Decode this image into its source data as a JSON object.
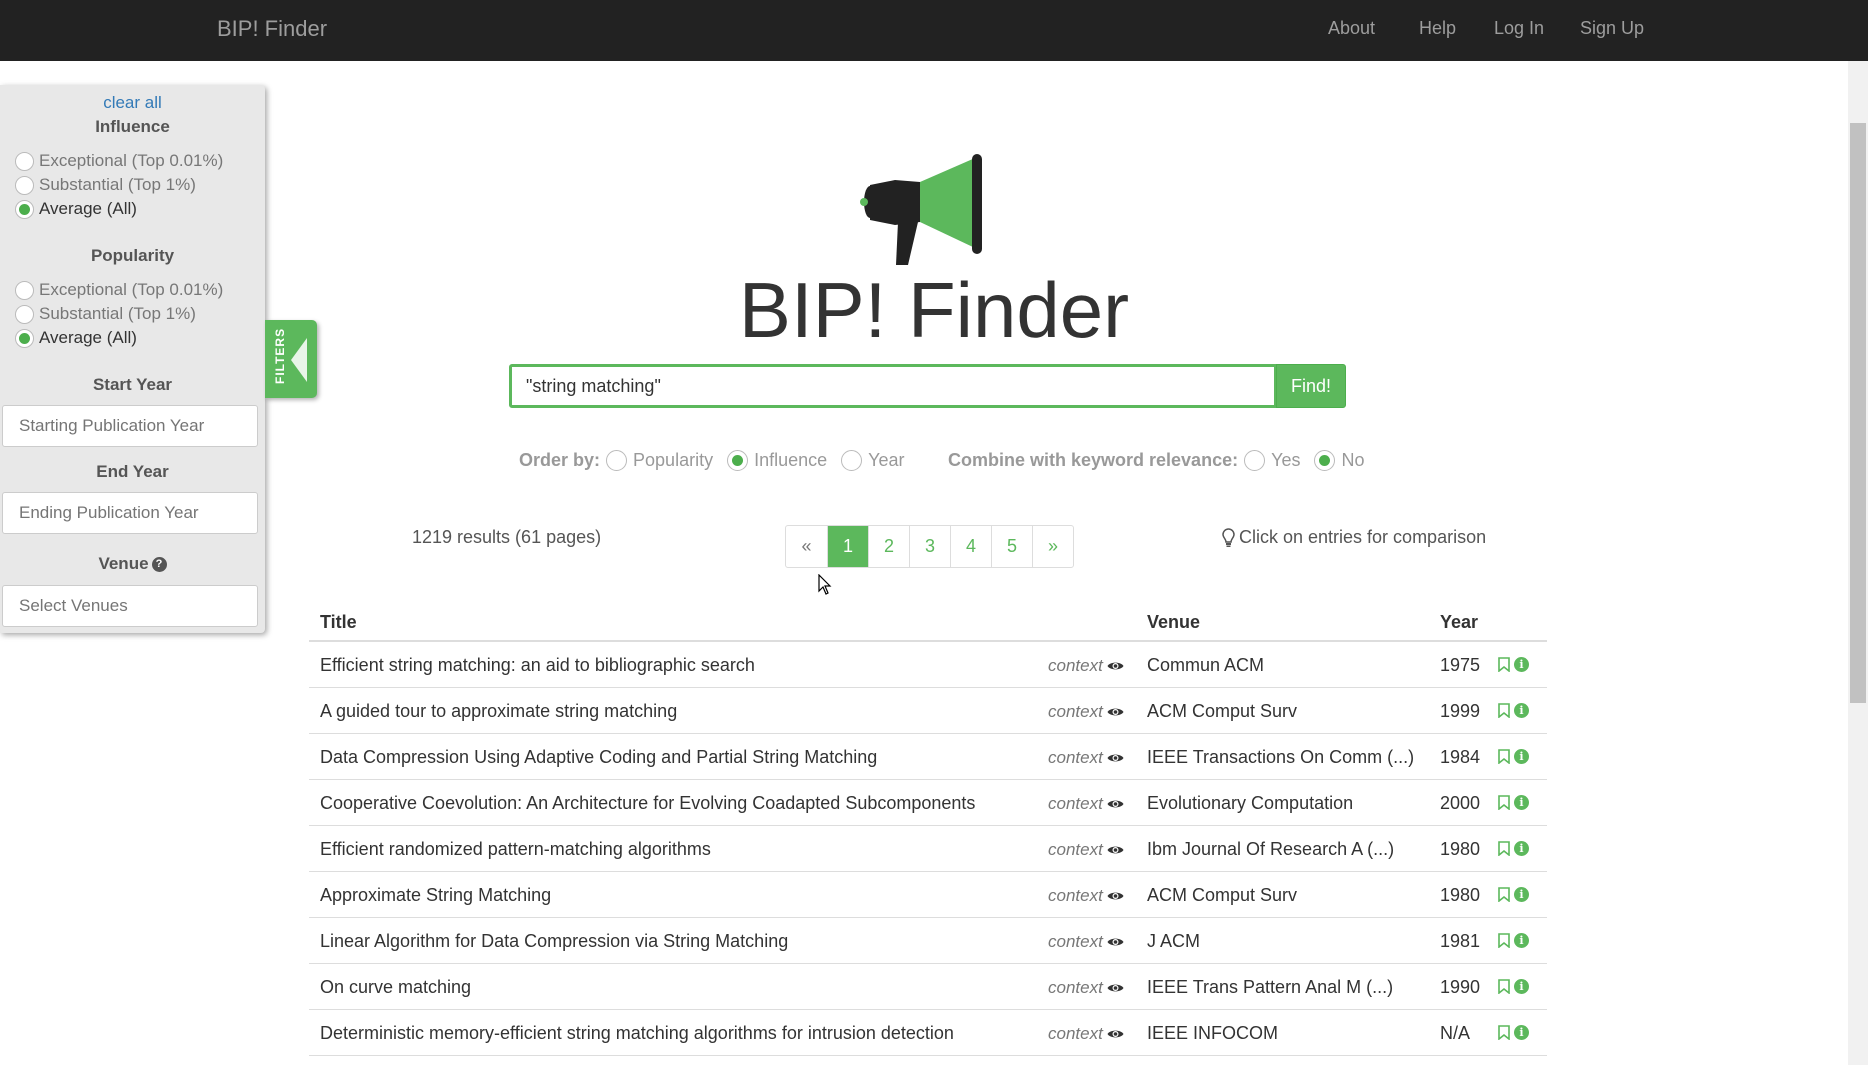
{
  "nav": {
    "brand": "BIP! Finder",
    "links": [
      {
        "label": "About",
        "key": "about"
      },
      {
        "label": "Help",
        "key": "help"
      },
      {
        "label": "Log In",
        "key": "login"
      },
      {
        "label": "Sign Up",
        "key": "signup"
      }
    ]
  },
  "filters": {
    "clear_all": "clear all",
    "influence": {
      "heading": "Influence",
      "options": [
        "Exceptional (Top 0.01%)",
        "Substantial (Top 1%)",
        "Average (All)"
      ],
      "selected": "Average (All)"
    },
    "popularity": {
      "heading": "Popularity",
      "options": [
        "Exceptional (Top 0.01%)",
        "Substantial (Top 1%)",
        "Average (All)"
      ],
      "selected": "Average (All)"
    },
    "start_year": {
      "heading": "Start Year",
      "placeholder": "Starting Publication Year"
    },
    "end_year": {
      "heading": "End Year",
      "placeholder": "Ending Publication Year"
    },
    "venue": {
      "heading": "Venue",
      "help_icon": "question-circle-icon",
      "placeholder": "Select Venues"
    },
    "tab_label": "FILTERS"
  },
  "hero": {
    "title": "BIP! Finder",
    "logo_icon": "megaphone-icon",
    "colors": {
      "green": "#5cb85c",
      "dark": "#222222"
    }
  },
  "search": {
    "value": "\"string matching\"",
    "button": "Find!"
  },
  "order": {
    "label": "Order by:",
    "options": [
      "Popularity",
      "Influence",
      "Year"
    ],
    "selected": "Influence",
    "combine_label": "Combine with keyword relevance:",
    "combine_options": [
      "Yes",
      "No"
    ],
    "combine_selected": "No"
  },
  "results": {
    "count_text": "1219 results (61 pages)",
    "pages": [
      "«",
      "1",
      "2",
      "3",
      "4",
      "5",
      "»"
    ],
    "active_page": "1",
    "compare_hint": "Click on entries for comparison"
  },
  "table": {
    "headers": {
      "title": "Title",
      "venue": "Venue",
      "year": "Year"
    },
    "context_label": "context",
    "rows": [
      {
        "title": "Efficient string matching: an aid to bibliographic search",
        "venue": "Commun ACM",
        "year": "1975"
      },
      {
        "title": "A guided tour to approximate string matching",
        "venue": "ACM Comput Surv",
        "year": "1999"
      },
      {
        "title": "Data Compression Using Adaptive Coding and Partial String Matching",
        "venue": "IEEE Transactions On Comm (...)",
        "year": "1984"
      },
      {
        "title": "Cooperative Coevolution: An Architecture for Evolving Coadapted Subcomponents",
        "venue": "Evolutionary Computation",
        "year": "2000"
      },
      {
        "title": "Efficient randomized pattern-matching algorithms",
        "venue": "Ibm Journal Of Research A (...)",
        "year": "1980"
      },
      {
        "title": "Approximate String Matching",
        "venue": "ACM Comput Surv",
        "year": "1980"
      },
      {
        "title": "Linear Algorithm for Data Compression via String Matching",
        "venue": "J ACM",
        "year": "1981"
      },
      {
        "title": "On curve matching",
        "venue": "IEEE Trans Pattern Anal M (...)",
        "year": "1990"
      },
      {
        "title": "Deterministic memory-efficient string matching algorithms for intrusion detection",
        "venue": "IEEE INFOCOM",
        "year": "N/A"
      }
    ]
  }
}
